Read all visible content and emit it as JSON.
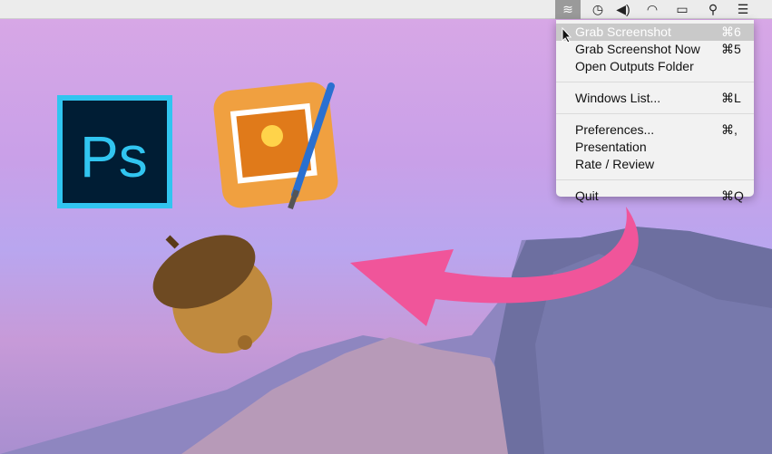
{
  "menubar": {
    "icons": [
      "layers-icon",
      "time-machine-icon",
      "volume-icon",
      "wifi-icon",
      "battery-icon",
      "search-icon",
      "list-icon"
    ]
  },
  "menu": {
    "groups": [
      [
        {
          "label": "Grab Screenshot",
          "key": "⌘6",
          "highlighted": true
        },
        {
          "label": "Grab Screenshot Now",
          "key": "⌘5"
        },
        {
          "label": "Open Outputs Folder",
          "key": ""
        }
      ],
      [
        {
          "label": "Windows List...",
          "key": "⌘L"
        }
      ],
      [
        {
          "label": "Preferences...",
          "key": "⌘,"
        },
        {
          "label": "Presentation",
          "key": ""
        },
        {
          "label": "Rate / Review",
          "key": ""
        }
      ],
      [
        {
          "label": "Quit",
          "key": "⌘Q"
        }
      ]
    ]
  },
  "desktop": {
    "app_icons": [
      "photoshop-icon",
      "pixelmator-icon",
      "acorn-icon"
    ],
    "ps_logo": "Ps",
    "arrow_color": "#f0559a"
  }
}
